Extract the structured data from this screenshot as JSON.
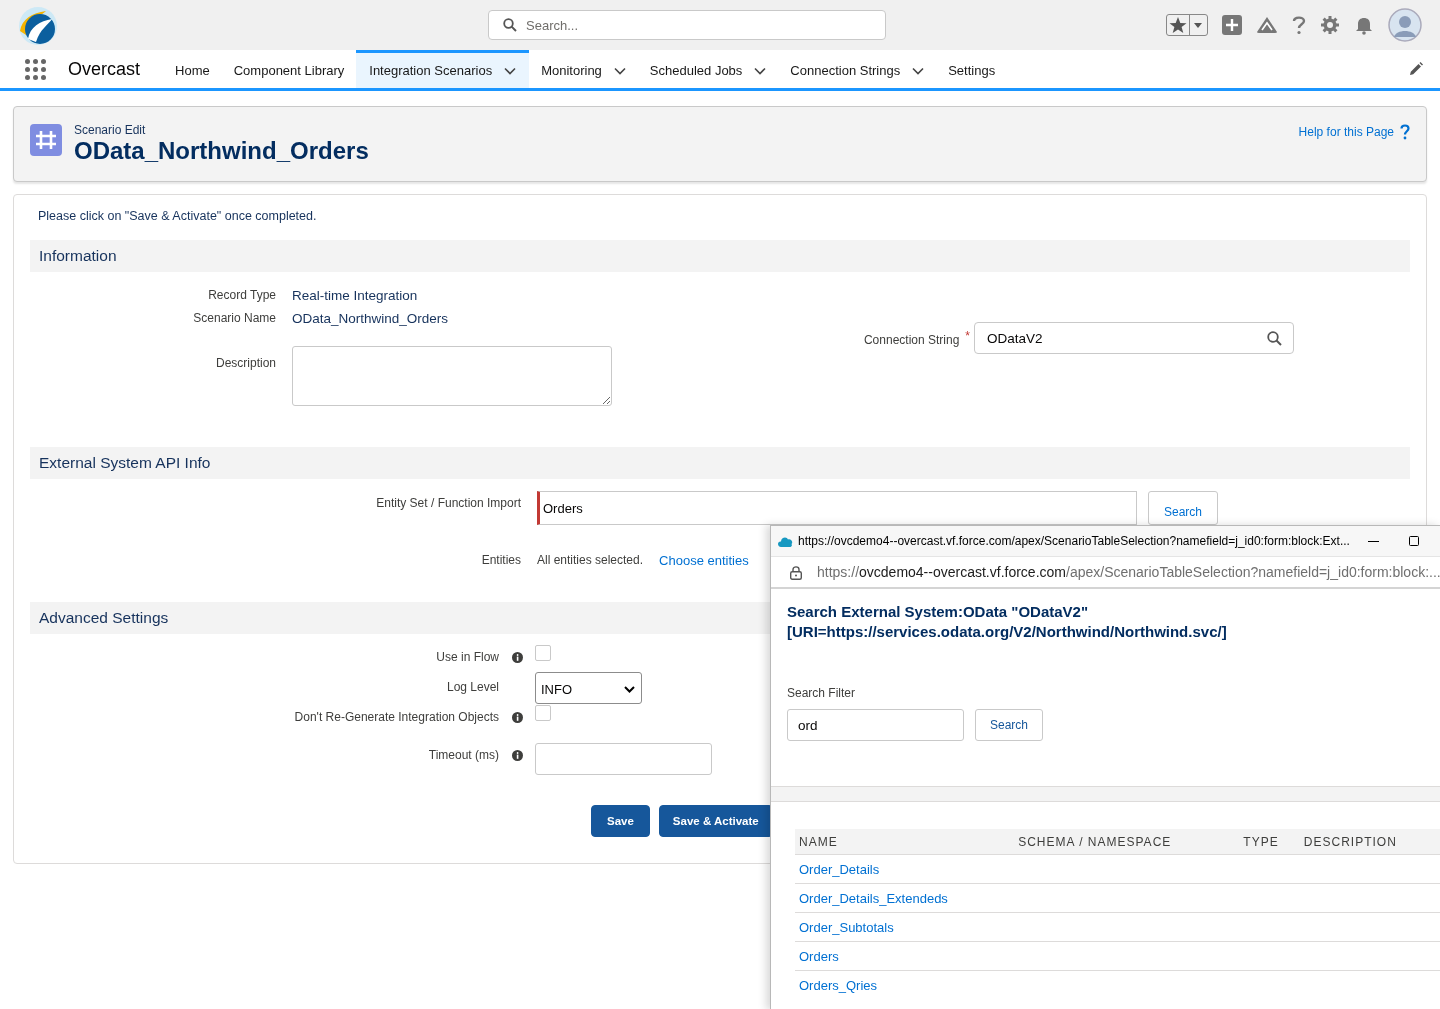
{
  "header": {
    "search_placeholder": "Search..."
  },
  "app_name": "Overcast",
  "nav": [
    {
      "label": "Home",
      "selected": false,
      "dropdown": false
    },
    {
      "label": "Component Library",
      "selected": false,
      "dropdown": false
    },
    {
      "label": "Integration Scenarios",
      "selected": true,
      "dropdown": true
    },
    {
      "label": "Monitoring",
      "selected": false,
      "dropdown": true
    },
    {
      "label": "Scheduled Jobs",
      "selected": false,
      "dropdown": true
    },
    {
      "label": "Connection Strings",
      "selected": false,
      "dropdown": true
    },
    {
      "label": "Settings",
      "selected": false,
      "dropdown": false
    }
  ],
  "page_header": {
    "subtitle": "Scenario Edit",
    "title": "OData_Northwind_Orders",
    "help_link": "Help for this Page"
  },
  "notice": "Please click on \"Save & Activate\" once completed.",
  "sections": [
    {
      "heading": "Information",
      "fields": [
        {
          "kind": "text",
          "label": "Record Type",
          "value": "Real-time Integration"
        },
        {
          "kind": "text",
          "label": "Scenario Name",
          "value": "OData_Northwind_Orders"
        },
        {
          "kind": "textarea",
          "label": "Description"
        }
      ],
      "side_fields": [
        {
          "kind": "lookup",
          "label": "Connection String",
          "required_mark": "*",
          "value": "ODataV2"
        }
      ]
    },
    {
      "heading": "External System API Info",
      "fields": [
        {
          "kind": "entity",
          "label": "Entity Set / Function Import",
          "required": true,
          "value": "Orders",
          "button": "Search"
        },
        {
          "kind": "entities",
          "label": "Entities",
          "value": "All entities selected.",
          "link": "Choose entities"
        }
      ]
    },
    {
      "heading": "Advanced Settings",
      "fields": [
        {
          "kind": "checkbox",
          "label": "Use in Flow",
          "info": true,
          "checked": false
        },
        {
          "kind": "select",
          "label": "Log Level",
          "info": false,
          "value": "INFO"
        },
        {
          "kind": "checkbox",
          "label": "Don't Re-Generate Integration Objects",
          "info": true,
          "checked": false
        },
        {
          "kind": "input",
          "label": "Timeout (ms)",
          "info": true
        }
      ]
    }
  ],
  "buttons": [
    "Save",
    "Save & Activate"
  ],
  "popup": {
    "title": "https://ovcdemo4--overcast.vf.force.com/apex/ScenarioTableSelection?namefield=j_id0:form:block:Ext...",
    "address": {
      "scheme": "https://",
      "host": "ovcdemo4--overcast.vf.force.com",
      "path": "/apex/ScenarioTableSelection?namefield=j_id0:form:block:..."
    },
    "heading_lines": [
      "Search External System:OData \"ODataV2\"",
      "[URI=https://services.odata.org/V2/Northwind/Northwind.svc/]"
    ],
    "filter_label": "Search Filter",
    "filter_value": "ord",
    "search_button": "Search",
    "columns": [
      "NAME",
      "SCHEMA / NAMESPACE",
      "TYPE",
      "DESCRIPTION"
    ],
    "rows": [
      {
        "name": "Order_Details"
      },
      {
        "name": "Order_Details_Extendeds"
      },
      {
        "name": "Order_Subtotals"
      },
      {
        "name": "Orders"
      },
      {
        "name": "Orders_Qries"
      }
    ]
  }
}
